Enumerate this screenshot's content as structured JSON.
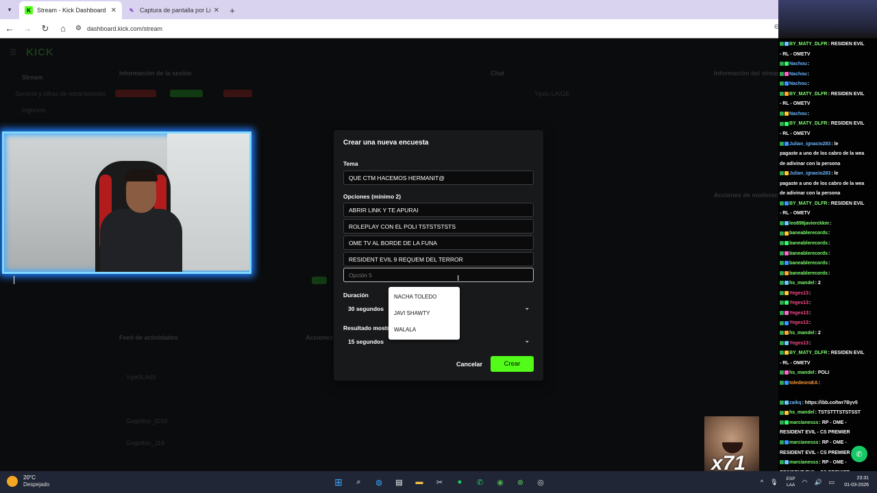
{
  "browser": {
    "tabs": [
      {
        "title": "Stream - Kick Dashboard",
        "active": true
      },
      {
        "title": "Captura de pantalla por Lightsh",
        "active": false
      }
    ],
    "url": "dashboard.kick.com/stream"
  },
  "dashboard": {
    "logo": "KICK",
    "nav": [
      "Stream",
      "Servicio y cifras de retransmisión",
      "Ingresos"
    ],
    "panels": [
      "Información de la sesión",
      "Chat",
      "Información del stream",
      "Acciones de moderación",
      "Feed de actividades",
      "Acciones rápidas"
    ],
    "chat_users": [
      "Yipito LAIGE",
      "Yipit0LA69",
      "Gogoltoo_ID16",
      "Gogoltoo_J16"
    ]
  },
  "modal": {
    "title": "Crear una nueva encuesta",
    "topic_label": "Tema",
    "topic_value": "QUE CTM HACEMOS HERMANIT@",
    "options_label": "Opciones (mínimo 2)",
    "options": [
      "ABRIR LINK Y TE APURAI",
      "ROLEPLAY CON EL POLI TSTSTSTSTS",
      "OME TV AL BORDE DE LA FUNA",
      "RESIDENT EVIL 9 REQUEM DEL TERROR"
    ],
    "option5_placeholder": "Opción 5",
    "duration_label": "Duración",
    "duration_value": "30 segundos",
    "result_label": "Resultado mostr",
    "result_value": "15 segundos",
    "cancel_label": "Cancelar",
    "create_label": "Crear"
  },
  "autocomplete": [
    "NACHA TOLEDO",
    "JAVI SHAWTY",
    "WALALA"
  ],
  "chat_overlay": [
    {
      "user": "BY_MATY_DLFR",
      "text": ": RESIDEN EVIL"
    },
    {
      "user": "",
      "text": "- RL - OMETV"
    },
    {
      "user": "Nachou",
      "text": ":"
    },
    {
      "user": "Nachou",
      "text": ":"
    },
    {
      "user": "Nachou",
      "text": ":"
    },
    {
      "user": "BY_MATY_DLFR",
      "text": ": RESIDEN EVIL"
    },
    {
      "user": "",
      "text": "- RL - OMETV"
    },
    {
      "user": "Nachou",
      "text": ":"
    },
    {
      "user": "BY_MATY_DLFR",
      "text": ": RESIDEN EVIL"
    },
    {
      "user": "",
      "text": "- RL - OMETV"
    },
    {
      "user": "Julian_ignacio283",
      "text": ": le"
    },
    {
      "user": "",
      "text": "pagaste a uno de los cabro de la wea"
    },
    {
      "user": "",
      "text": "de adivinar con la persona"
    },
    {
      "user": "Julian_ignacio283",
      "text": ": le"
    },
    {
      "user": "",
      "text": "pagaste a uno de los cabro de la wea"
    },
    {
      "user": "",
      "text": "de adivinar con la persona"
    },
    {
      "user": "BY_MATY_DLFR",
      "text": ": RESIDEN EVIL"
    },
    {
      "user": "",
      "text": "- RL - OMETV"
    },
    {
      "user": "leo898javierckkm",
      "text": ":"
    },
    {
      "user": "baneablerecords",
      "text": ":"
    },
    {
      "user": "baneablerecords",
      "text": ":"
    },
    {
      "user": "baneablerecords",
      "text": ":"
    },
    {
      "user": "baneablerecords",
      "text": ":"
    },
    {
      "user": "baneablerecords",
      "text": ":"
    },
    {
      "user": "hs_mandel",
      "text": ": 2"
    },
    {
      "user": "Yeges13",
      "text": ":"
    },
    {
      "user": "Yeges13",
      "text": ":"
    },
    {
      "user": "Yeges13",
      "text": ":"
    },
    {
      "user": "Yeges13",
      "text": ":"
    },
    {
      "user": "hs_mandel",
      "text": ": 2"
    },
    {
      "user": "Yeges13",
      "text": ":"
    },
    {
      "user": "BY_MATY_DLFR",
      "text": ": RESIDEN EVIL"
    },
    {
      "user": "",
      "text": "- RL - OMETV"
    },
    {
      "user": "hs_mandel",
      "text": ": POLI"
    },
    {
      "user": "toledeoroEA",
      "text": ":"
    },
    {
      "user": "",
      "text": ""
    },
    {
      "user": "zaikq",
      "text": ": https://ibb.co/twr7Byv5"
    },
    {
      "user": "hs_mandel",
      "text": ": TSTSTTTSTSTSST"
    },
    {
      "user": "marcianesss",
      "text": ": RP - OME -"
    },
    {
      "user": "",
      "text": "RESIDENT EVIL - CS PREMIER"
    },
    {
      "user": "marcianesss",
      "text": ": RP - OME -"
    },
    {
      "user": "",
      "text": "RESIDENT EVIL - CS PREMIER"
    },
    {
      "user": "marcianesss",
      "text": ": RP - OME -"
    },
    {
      "user": "",
      "text": "RESIDENT EVIL - CS PREMIER"
    }
  ],
  "meme_text": "x71",
  "taskbar": {
    "weather_temp": "20°C",
    "weather_desc": "Despejado",
    "lang1": "ESP",
    "lang2": "LAA",
    "time": "23:31",
    "date": "01-03-2026"
  },
  "colors": {
    "kick_green": "#53fc18",
    "modal_bg": "#18191b",
    "cam_glow": "#1e7cff"
  }
}
